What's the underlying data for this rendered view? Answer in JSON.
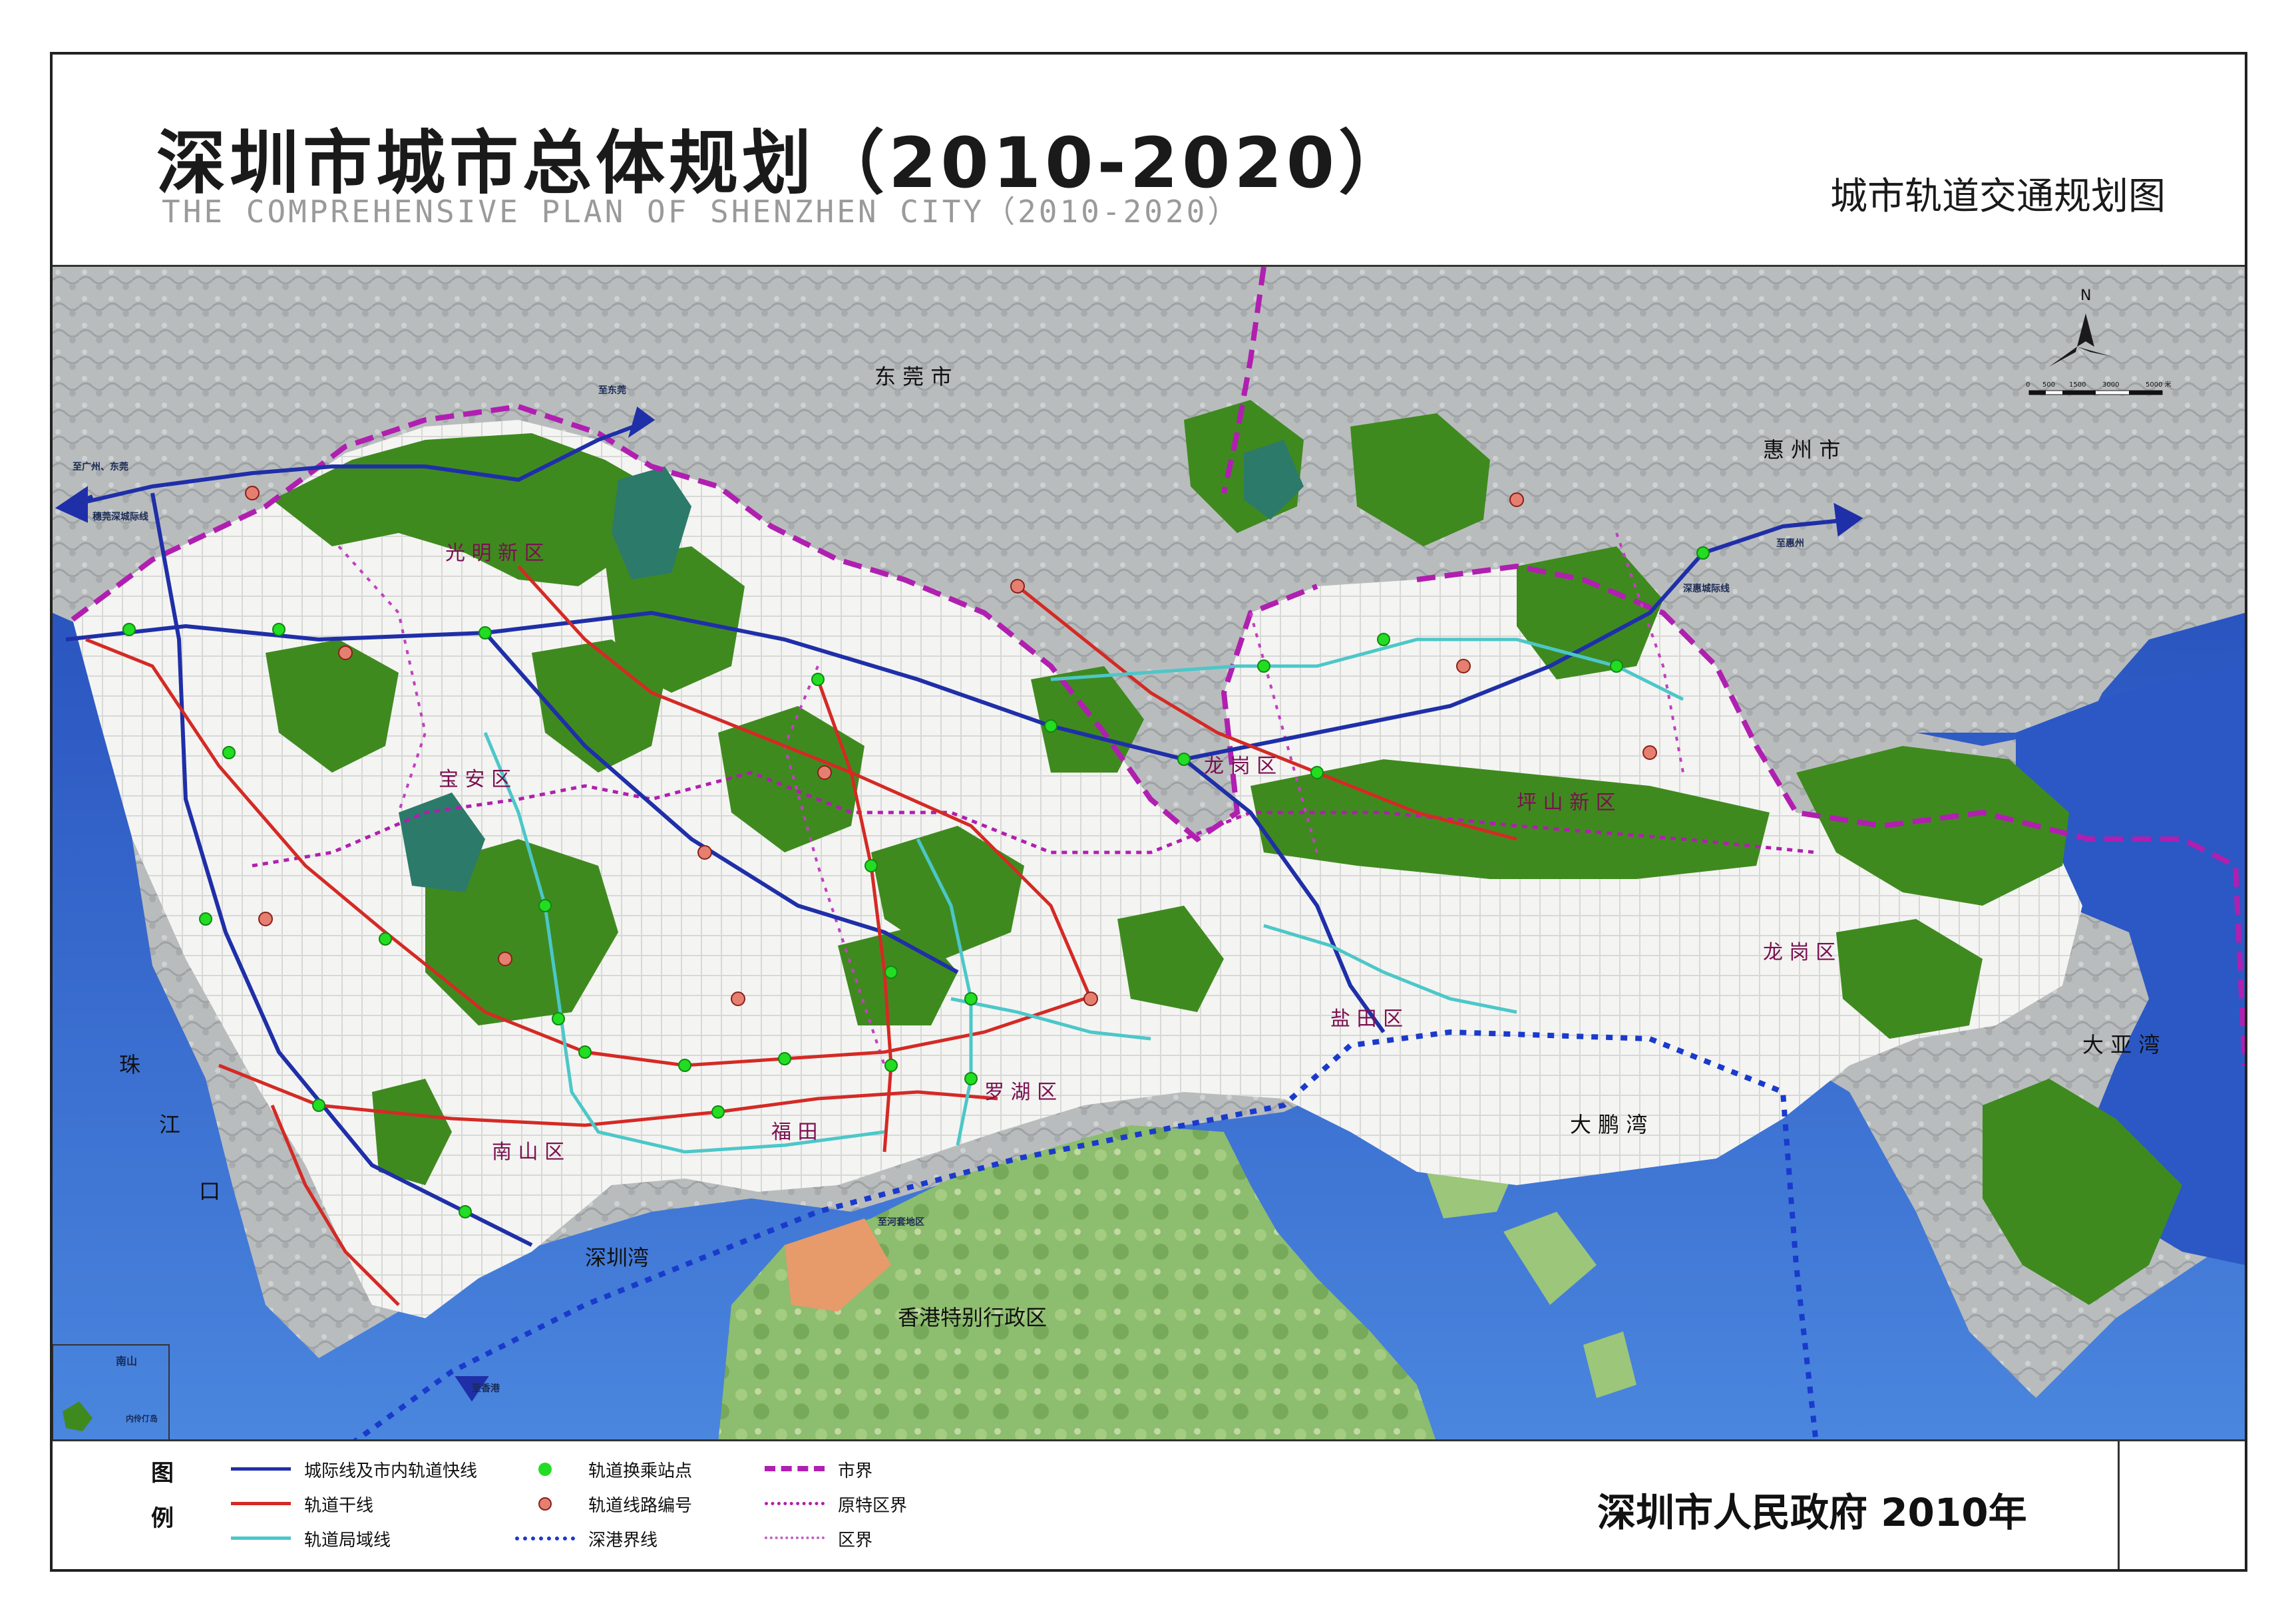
{
  "header": {
    "title": "深圳市城市总体规划（2010-2020）",
    "subtitle": "THE COMPREHENSIVE PLAN OF SHENZHEN CITY（2010-2020）",
    "map_type": "城市轨道交通规划图"
  },
  "map": {
    "neighbors": {
      "dongguan": "东  莞  市",
      "huizhou": "惠  州  市",
      "hongkong": "香港特别行政区"
    },
    "waters": {
      "pearl_river": [
        "珠",
        "江",
        "口"
      ],
      "shenzhen_bay": "深圳湾",
      "dapeng_bay": "大  鹏  湾",
      "daya_bay": "大  亚  湾"
    },
    "districts": {
      "guangming": "光 明 新 区",
      "baoan": "宝  安  区",
      "longgang_w": "龙  岗  区",
      "pingshan": "坪  山  新  区",
      "longgang_e": "龙  岗  区",
      "yantian": "盐 田 区",
      "luohu": "罗 湖 区",
      "futian": "福 田",
      "nanshan": "南 山 区"
    },
    "annotations": {
      "to_guangzhou": "至广州、东莞",
      "intercity_guanshen": "穗莞深城际线",
      "to_dongguan": "至东莞",
      "to_huizhou": "至惠州",
      "intercity_shenhui": "深惠城际线",
      "to_hongkong": "至香港",
      "to_hk_border": "至河套地区",
      "nanshan_island": "南山",
      "inset_label": "内伶仃岛"
    },
    "compass": {
      "north": "N",
      "scale": [
        "0",
        "500",
        "1500",
        "3000",
        "5000 米"
      ]
    },
    "colors": {
      "sea": "#2f62c9",
      "green_land": "#3f8a1f",
      "intercity_line": "#1f2fa8",
      "trunk_line": "#d42a25",
      "local_line": "#4cc7c9",
      "station": "#22dd22",
      "city_boundary": "#b01fb0",
      "hk_boundary": "#1a3acc"
    }
  },
  "legend": {
    "title_chars": [
      "图",
      "例"
    ],
    "items": [
      {
        "label": "城际线及市内轨道快线",
        "symbol": "blue-line"
      },
      {
        "label": "轨道干线",
        "symbol": "red-line"
      },
      {
        "label": "轨道局域线",
        "symbol": "cyan-line"
      },
      {
        "label": "轨道换乘站点",
        "symbol": "green-dot"
      },
      {
        "label": "轨道线路编号",
        "symbol": "number-badge"
      },
      {
        "label": "深港界线",
        "symbol": "blue-dotted"
      },
      {
        "label": "市界",
        "symbol": "magenta-dashed"
      },
      {
        "label": "原特区界",
        "symbol": "magenta-dotted"
      },
      {
        "label": "区界",
        "symbol": "magenta-dotted-light"
      }
    ],
    "issuer": "深圳市人民政府 2010年"
  }
}
